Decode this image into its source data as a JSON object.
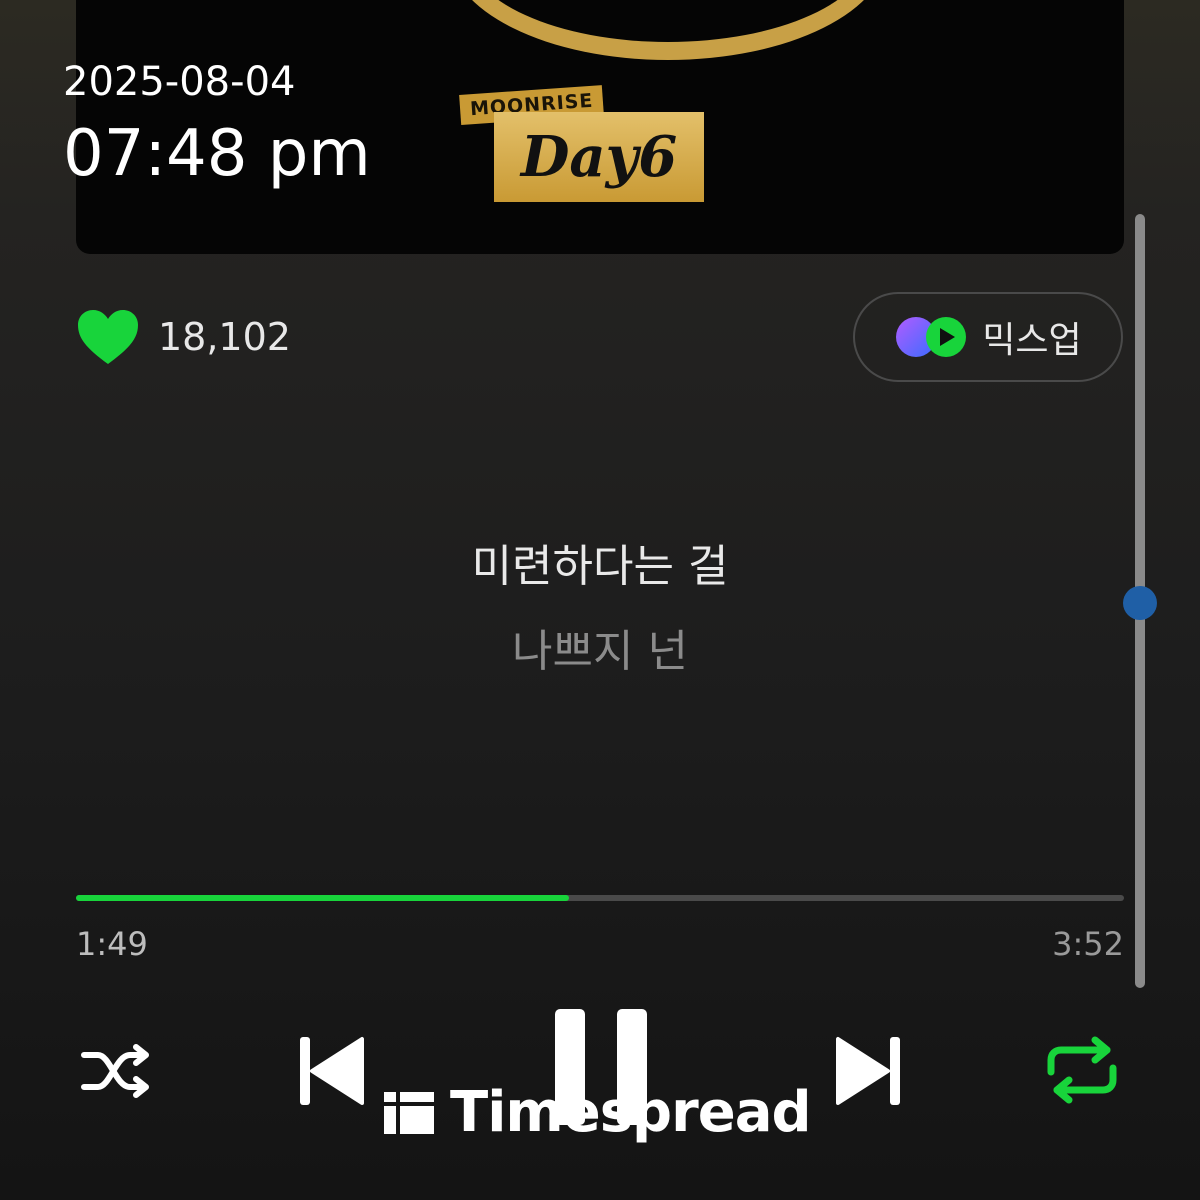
{
  "status": {
    "date": "2025-08-04",
    "time": "07:48 pm"
  },
  "album": {
    "badge_top": "MOONRISE",
    "badge_main": "Day6"
  },
  "like": {
    "count": "18,102",
    "icon": "heart-icon",
    "color": "#18d43b"
  },
  "mixup": {
    "label": "믹스업",
    "icon": "mixup-icon"
  },
  "lyrics": {
    "current": "미련하다는 걸",
    "next": "나쁘지 넌"
  },
  "progress": {
    "elapsed": "1:49",
    "total": "3:52",
    "fraction": 0.47
  },
  "controls": {
    "shuffle": "shuffle-icon",
    "previous": "previous-icon",
    "pause": "pause-icon",
    "next": "next-icon",
    "repeat": "repeat-icon",
    "repeat_color": "#18d43b"
  },
  "watermark": {
    "text": "Timespread"
  },
  "colors": {
    "accent": "#18d43b",
    "background": "#1d1d1d"
  }
}
